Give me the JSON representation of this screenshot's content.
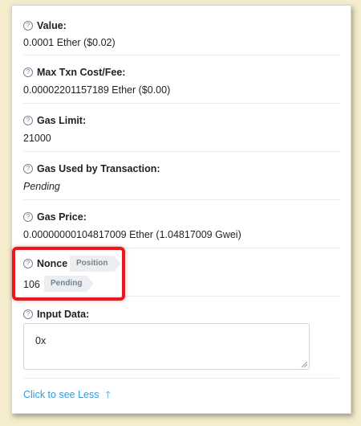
{
  "fields": {
    "value": {
      "label": "Value:",
      "value": "0.0001 Ether ($0.02)"
    },
    "max_fee": {
      "label": "Max Txn Cost/Fee:",
      "value": "0.00002201157189 Ether ($0.00)"
    },
    "gas_limit": {
      "label": "Gas Limit:",
      "value": "21000"
    },
    "gas_used": {
      "label": "Gas Used by Transaction:",
      "value": "Pending"
    },
    "gas_price": {
      "label": "Gas Price:",
      "value": "0.00000000104817009 Ether (1.04817009 Gwei)"
    },
    "nonce": {
      "label": "Nonce",
      "position_tag": "Position",
      "value": "106",
      "pending_tag": "Pending"
    },
    "input_data": {
      "label": "Input Data:",
      "value": "0x"
    }
  },
  "help_icon_glyph": "?",
  "toggle": {
    "label": "Click to see Less",
    "arrow": "🡑"
  },
  "colors": {
    "background": "#f5eccc",
    "link": "#3498db",
    "highlight": "#e8191c",
    "tag_bg": "#eceef2"
  }
}
